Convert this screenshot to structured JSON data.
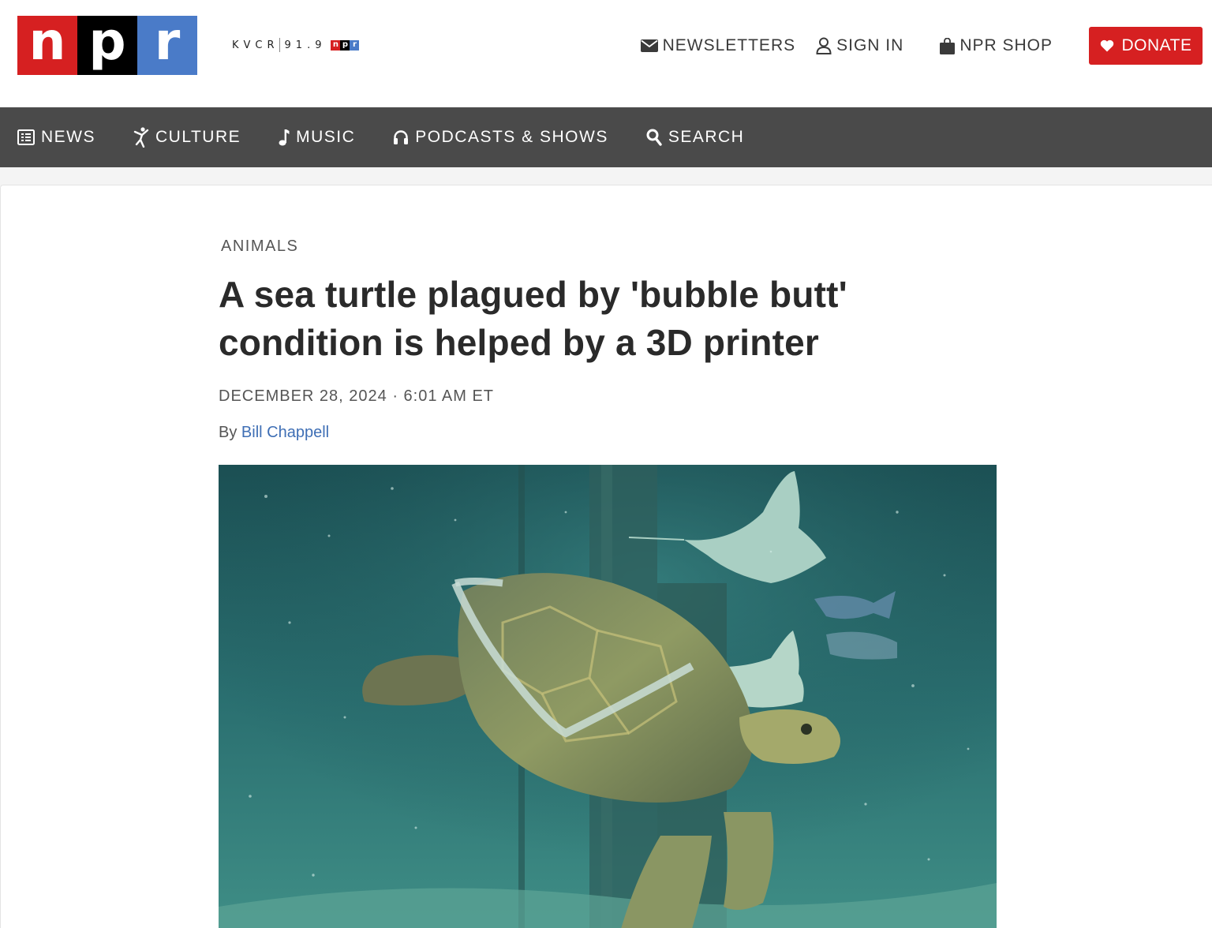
{
  "header": {
    "logo_letters": [
      "n",
      "p",
      "r"
    ],
    "station": {
      "call_sign": "KVCR",
      "frequency": "91.9",
      "mini_logo": [
        "n",
        "p",
        "r"
      ]
    },
    "utility": {
      "newsletters": "NEWSLETTERS",
      "sign_in": "SIGN IN",
      "shop": "NPR SHOP",
      "donate": "DONATE"
    },
    "icons": {
      "newsletters": "envelope-icon",
      "sign_in": "user-icon",
      "shop": "shopping-bag-icon",
      "donate": "heart-icon"
    }
  },
  "nav": {
    "items": [
      {
        "label": "NEWS",
        "icon": "news-list-icon"
      },
      {
        "label": "CULTURE",
        "icon": "dancer-icon"
      },
      {
        "label": "MUSIC",
        "icon": "music-note-icon"
      },
      {
        "label": "PODCASTS & SHOWS",
        "icon": "headphones-icon"
      },
      {
        "label": "SEARCH",
        "icon": "search-icon"
      }
    ]
  },
  "article": {
    "section": "ANIMALS",
    "headline": "A sea turtle plagued by 'bubble butt' condition is helped by a 3D printer",
    "dateline": "DECEMBER 28, 2024 · 6:01 AM ET",
    "byline_prefix": "By",
    "author": "Bill Chappell"
  },
  "colors": {
    "brand_red": "#d62021",
    "brand_black": "#000000",
    "brand_blue": "#4a7bc8",
    "nav_bg": "#4a4a4a",
    "link_blue": "#3f6fb5"
  }
}
